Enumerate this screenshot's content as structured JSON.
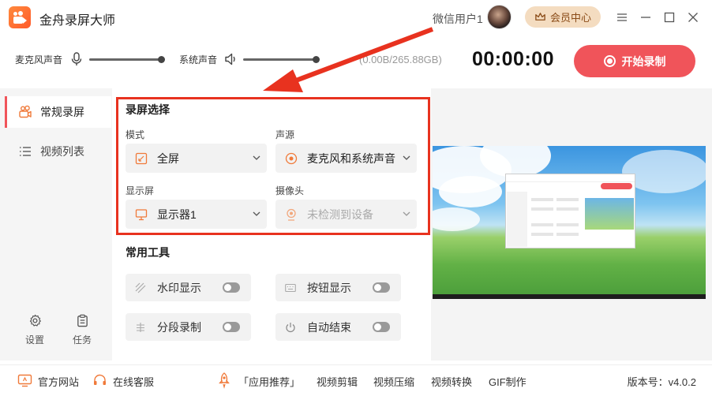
{
  "app": {
    "title": "金舟录屏大师",
    "user": "微信用户1",
    "vip_label": "会员中心"
  },
  "audio": {
    "mic_label": "麦克风声音",
    "system_label": "系统声音",
    "mic_level": 1.0,
    "system_level": 1.0,
    "disk": "(0.00B/265.88GB)"
  },
  "timer": "00:00:00",
  "record_label": "开始录制",
  "sidebar": {
    "items": [
      {
        "label": "常规录屏",
        "icon": "camera-icon",
        "active": true
      },
      {
        "label": "视频列表",
        "icon": "list-icon",
        "active": false
      }
    ],
    "settings_label": "设置",
    "tasks_label": "任务"
  },
  "capture": {
    "title": "录屏选择",
    "mode_label": "模式",
    "mode_value": "全屏",
    "audio_label": "声源",
    "audio_value": "麦克风和系统声音",
    "display_label": "显示屏",
    "display_value": "显示器1",
    "camera_label": "摄像头",
    "camera_value": "未检测到设备"
  },
  "tools": {
    "title": "常用工具",
    "items": [
      {
        "label": "水印显示",
        "on": false
      },
      {
        "label": "按钮显示",
        "on": false
      },
      {
        "label": "分段录制",
        "on": false
      },
      {
        "label": "自动结束",
        "on": false
      }
    ]
  },
  "footer": {
    "website": "官方网站",
    "support": "在线客服",
    "recommend": "「应用推荐」",
    "links": [
      "视频剪辑",
      "视频压缩",
      "视频转换",
      "GIF制作"
    ],
    "version": "版本号：v4.0.2"
  },
  "colors": {
    "accent": "#f0545a",
    "highlight_box": "#e8321f",
    "vip_bg": "#f4dcc0"
  }
}
